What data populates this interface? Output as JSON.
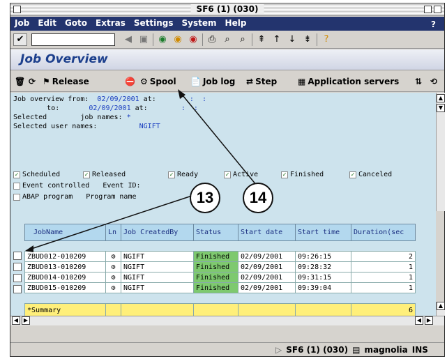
{
  "window": {
    "title": "SF6 (1) (030)"
  },
  "menu": [
    "Job",
    "Edit",
    "Goto",
    "Extras",
    "Settings",
    "System",
    "Help"
  ],
  "menu_help": "?",
  "standard_toolbar": {
    "ok_icon": "check-icon",
    "command_field": ""
  },
  "page_title": "Job Overview",
  "app_toolbar": {
    "release": "Release",
    "spool": "Spool",
    "job_log": "Job log",
    "step": "Step",
    "app_servers": "Application servers"
  },
  "selection": {
    "line1_label": "Job overview from:",
    "from_date": "02/09/2001",
    "at1": "at:",
    "time1": ":  :",
    "line2_label": "to:",
    "to_date": "02/09/2001",
    "at2": "at:",
    "time2": ":  :",
    "selected_label": "Selected",
    "job_names_label": "job names:",
    "job_names_value": "*",
    "user_names_label": "Selected user names:",
    "user_names_value": "NGIFT"
  },
  "status_filters": [
    {
      "label": "Scheduled",
      "checked": true
    },
    {
      "label": "Released",
      "checked": true
    },
    {
      "label": "Ready",
      "checked": true
    },
    {
      "label": "Active",
      "checked": true
    },
    {
      "label": "Finished",
      "checked": true
    },
    {
      "label": "Canceled",
      "checked": true
    }
  ],
  "event_controlled": "Event controlled",
  "event_id_label": "Event ID:",
  "abap_program": "ABAP program",
  "program_name_label": "Program name",
  "table": {
    "headers": [
      "JobName",
      "Ln",
      "Job CreatedBy",
      "Status",
      "Start date",
      "Start time",
      "Duration(sec"
    ],
    "rows": [
      {
        "name": "ZBUD012-010209",
        "created": "NGIFT",
        "status": "Finished",
        "date": "02/09/2001",
        "time": "09:26:15",
        "dur": "2"
      },
      {
        "name": "ZBUD013-010209",
        "created": "NGIFT",
        "status": "Finished",
        "date": "02/09/2001",
        "time": "09:28:32",
        "dur": "1"
      },
      {
        "name": "ZBUD014-010209",
        "created": "NGIFT",
        "status": "Finished",
        "date": "02/09/2001",
        "time": "09:31:15",
        "dur": "1"
      },
      {
        "name": "ZBUD015-010209",
        "created": "NGIFT",
        "status": "Finished",
        "date": "02/09/2001",
        "time": "09:39:04",
        "dur": "1"
      }
    ],
    "summary_label": "*Summary",
    "summary_dur": "6"
  },
  "status_bar": {
    "session": "SF6 (1) (030)",
    "server": "magnolia",
    "mode": "INS"
  },
  "callouts": {
    "a": "13",
    "b": "14"
  }
}
